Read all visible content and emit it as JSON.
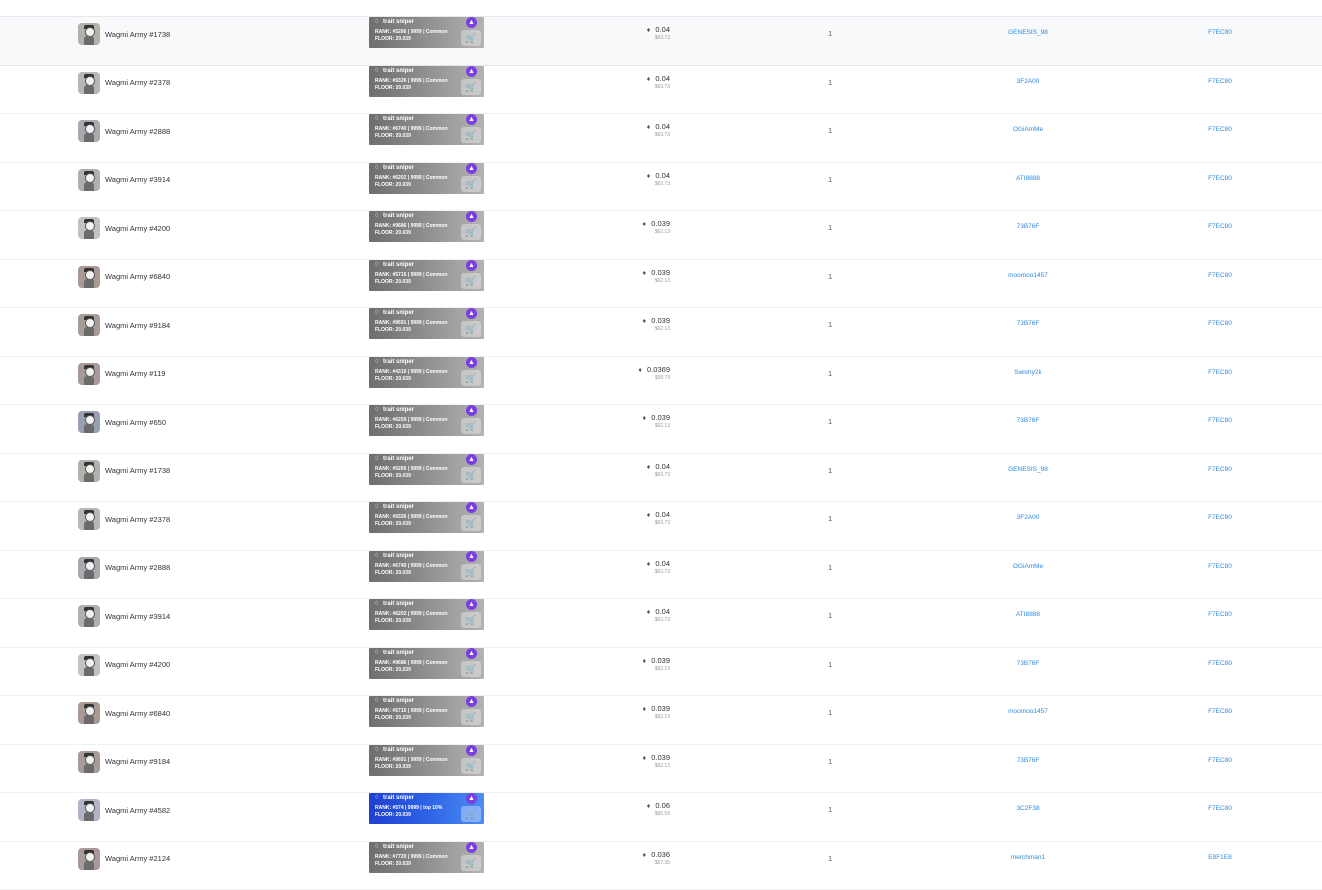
{
  "rows": [
    {
      "name": "Wagmi Army #1738",
      "rank": "RANK: #5266 | 9999 | Common",
      "floor": "FLOOR: 20.039",
      "eth": "0.04",
      "usd": "$63.73",
      "qty": "1",
      "from": "GENESIS_98",
      "to": "F7EC80",
      "highlight": true,
      "blue": false,
      "thumb": "#b4b1ad"
    },
    {
      "name": "Wagmi Army #2378",
      "rank": "RANK: #9326 | 9999 | Common",
      "floor": "FLOOR: 20.039",
      "eth": "0.04",
      "usd": "$63.73",
      "qty": "1",
      "from": "3F2A00",
      "to": "F7EC80",
      "highlight": false,
      "blue": false,
      "thumb": "#b9b6b3"
    },
    {
      "name": "Wagmi Army #2888",
      "rank": "RANK: #6740 | 9999 | Common",
      "floor": "FLOOR: 20.039",
      "eth": "0.04",
      "usd": "$63.73",
      "qty": "1",
      "from": "OGiAmMe",
      "to": "F7EC80",
      "highlight": false,
      "blue": false,
      "thumb": "#a8aab0"
    },
    {
      "name": "Wagmi Army #3914",
      "rank": "RANK: #6202 | 9999 | Common",
      "floor": "FLOOR: 20.039",
      "eth": "0.04",
      "usd": "$63.73",
      "qty": "1",
      "from": "ATI8888",
      "to": "F7EC80",
      "highlight": false,
      "blue": false,
      "thumb": "#b0b0b0"
    },
    {
      "name": "Wagmi Army #4200",
      "rank": "RANK: #9686 | 9999 | Common",
      "floor": "FLOOR: 20.039",
      "eth": "0.039",
      "usd": "$62.13",
      "qty": "1",
      "from": "73B76F",
      "to": "F7EC80",
      "highlight": false,
      "blue": false,
      "thumb": "#c2c2c2"
    },
    {
      "name": "Wagmi Army #6840",
      "rank": "RANK: #5715 | 9999 | Common",
      "floor": "FLOOR: 20.039",
      "eth": "0.039",
      "usd": "$62.13",
      "qty": "1",
      "from": "moomoo1457",
      "to": "F7EC80",
      "highlight": false,
      "blue": false,
      "thumb": "#a99a96"
    },
    {
      "name": "Wagmi Army #9184",
      "rank": "RANK: #9691 | 9999 | Common",
      "floor": "FLOOR: 20.039",
      "eth": "0.039",
      "usd": "$62.13",
      "qty": "1",
      "from": "73B76F",
      "to": "F7EC80",
      "highlight": false,
      "blue": false,
      "thumb": "#a89c98"
    },
    {
      "name": "Wagmi Army #119",
      "rank": "RANK: #4310 | 9999 | Common",
      "floor": "FLOOR: 20.039",
      "eth": "0.0369",
      "usd": "$58.79",
      "qty": "1",
      "from": "Swishy2k",
      "to": "F7EC80",
      "highlight": false,
      "blue": false,
      "thumb": "#a89a98"
    },
    {
      "name": "Wagmi Army #650",
      "rank": "RANK: #6259 | 9999 | Common",
      "floor": "FLOOR: 20.039",
      "eth": "0.039",
      "usd": "$62.13",
      "qty": "1",
      "from": "73B76F",
      "to": "F7EC80",
      "highlight": false,
      "blue": false,
      "thumb": "#9aa0b4"
    },
    {
      "name": "Wagmi Army #1738",
      "rank": "RANK: #5266 | 9999 | Common",
      "floor": "FLOOR: 20.039",
      "eth": "0.04",
      "usd": "$63.73",
      "qty": "1",
      "from": "GENESIS_98",
      "to": "F7EC80",
      "highlight": false,
      "blue": false,
      "thumb": "#b4b1ad"
    },
    {
      "name": "Wagmi Army #2378",
      "rank": "RANK: #9326 | 9999 | Common",
      "floor": "FLOOR: 20.039",
      "eth": "0.04",
      "usd": "$63.73",
      "qty": "1",
      "from": "3F2A00",
      "to": "F7EC80",
      "highlight": false,
      "blue": false,
      "thumb": "#b9b6b3"
    },
    {
      "name": "Wagmi Army #2888",
      "rank": "RANK: #6740 | 9999 | Common",
      "floor": "FLOOR: 20.039",
      "eth": "0.04",
      "usd": "$63.73",
      "qty": "1",
      "from": "OGiAmMe",
      "to": "F7EC80",
      "highlight": false,
      "blue": false,
      "thumb": "#a8aab0"
    },
    {
      "name": "Wagmi Army #3914",
      "rank": "RANK: #6202 | 9999 | Common",
      "floor": "FLOOR: 20.039",
      "eth": "0.04",
      "usd": "$63.73",
      "qty": "1",
      "from": "ATI8888",
      "to": "F7EC80",
      "highlight": false,
      "blue": false,
      "thumb": "#b0b0b0"
    },
    {
      "name": "Wagmi Army #4200",
      "rank": "RANK: #9686 | 9999 | Common",
      "floor": "FLOOR: 20.039",
      "eth": "0.039",
      "usd": "$62.13",
      "qty": "1",
      "from": "73B76F",
      "to": "F7EC80",
      "highlight": false,
      "blue": false,
      "thumb": "#c2c2c2"
    },
    {
      "name": "Wagmi Army #6840",
      "rank": "RANK: #5715 | 9999 | Common",
      "floor": "FLOOR: 20.039",
      "eth": "0.039",
      "usd": "$62.13",
      "qty": "1",
      "from": "moomoo1457",
      "to": "F7EC80",
      "highlight": false,
      "blue": false,
      "thumb": "#a99a96"
    },
    {
      "name": "Wagmi Army #9184",
      "rank": "RANK: #9691 | 9999 | Common",
      "floor": "FLOOR: 20.039",
      "eth": "0.039",
      "usd": "$62.13",
      "qty": "1",
      "from": "73B76F",
      "to": "F7EC80",
      "highlight": false,
      "blue": false,
      "thumb": "#a89c98"
    },
    {
      "name": "Wagmi Army #4582",
      "rank": "RANK: #574 | 9999 | top 10%",
      "floor": "FLOOR: 20.039",
      "eth": "0.06",
      "usd": "$95.59",
      "qty": "1",
      "from": "3C2F38",
      "to": "F7EC80",
      "highlight": false,
      "blue": true,
      "thumb": "#b0b4c4"
    },
    {
      "name": "Wagmi Army #2124",
      "rank": "RANK: #7720 | 9999 | Common",
      "floor": "FLOOR: 20.039",
      "eth": "0.036",
      "usd": "$57.35",
      "qty": "1",
      "from": "merchman1",
      "to": "E8F1E8",
      "highlight": false,
      "blue": false,
      "thumb": "#a89a98"
    }
  ],
  "trait_sniper_label": "trait sniper",
  "icons": {
    "diamond": "diamond-icon",
    "badge": "trait-sniper-logo-icon",
    "cart": "cart-icon",
    "eth": "ethereum-icon"
  },
  "colors": {
    "link": "#2f8ae0",
    "badge": "#7a3fe0",
    "banner_gray": "#8c8c8c",
    "banner_blue": "#2d62e6"
  }
}
